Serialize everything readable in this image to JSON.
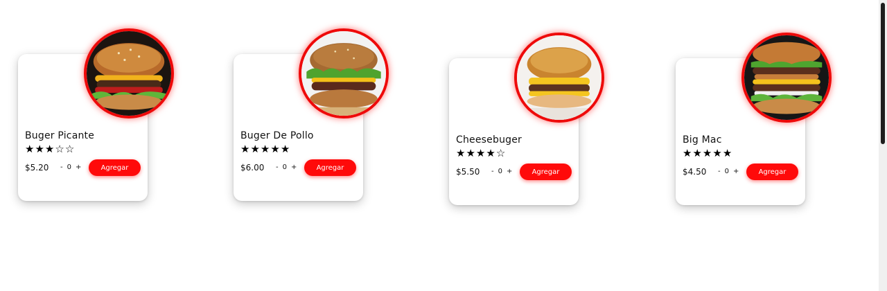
{
  "currency_note": "",
  "products": [
    {
      "name": "Buger Picante",
      "rating": 3,
      "price": "$5.20",
      "qty_minus": "-",
      "qty": "0",
      "qty_plus": "+",
      "button": "Agregar",
      "image": "burger-image"
    },
    {
      "name": "Buger De Pollo",
      "rating": 5,
      "price": "$6.00",
      "qty_minus": "-",
      "qty": "0",
      "qty_plus": "+",
      "button": "Agregar",
      "image": "burger-image"
    },
    {
      "name": "Cheesebuger",
      "rating": 4,
      "price": "$5.50",
      "qty_minus": "-",
      "qty": "0",
      "qty_plus": "+",
      "button": "Agregar",
      "image": "burger-image"
    },
    {
      "name": "Big Mac",
      "rating": 5,
      "price": "$4.50",
      "qty_minus": "-",
      "qty": "0",
      "qty_plus": "+",
      "button": "Agregar",
      "image": "burger-image"
    }
  ],
  "rating_max": 5,
  "colors": {
    "accent": "#ff0a0a",
    "ring": "#ee0a0a",
    "text": "#111111",
    "background": "#ffffff"
  }
}
